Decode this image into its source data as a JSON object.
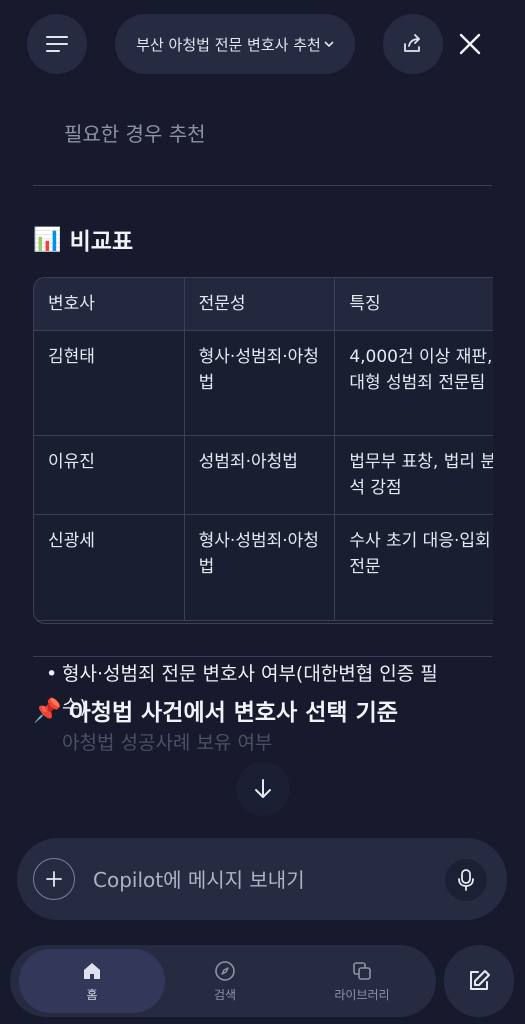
{
  "header": {
    "title": "부산 아청법 전문 변호사 추천",
    "menu_icon": "hamburger-icon",
    "share_icon": "share-icon",
    "close_icon": "close-icon"
  },
  "content": {
    "prev_text": "필요한 경우 추천",
    "comparison_title": "비교표",
    "comparison_emoji": "📊",
    "table": {
      "headers": [
        "변호사",
        "전문성",
        "특징"
      ],
      "rows": [
        [
          "김현태",
          "형사·성범죄·아청법",
          "4,000건 이상 재판, 대형 성범죄 전문팀"
        ],
        [
          "이유진",
          "성범죄·아청법",
          "법무부 표창, 법리 분석 강점"
        ],
        [
          "신광세",
          "형사·성범죄·아청법",
          "수사 초기 대응·입회 전문"
        ]
      ]
    },
    "criteria_title": "아청법 사건에서 변호사 선택 기준",
    "criteria_emoji": "📌",
    "bullets": [
      "형사·성범죄 전문 변호사 여부(대한변협 인증 필수)",
      "아청법 성공사례 보유 여부"
    ]
  },
  "composer": {
    "placeholder": "Copilot에 메시지 보내기"
  },
  "nav": {
    "home": "홈",
    "search": "검색",
    "library": "라이브러리"
  },
  "colors": {
    "background": "#161a2c",
    "surface": "#262b42",
    "border": "#3b4058"
  }
}
